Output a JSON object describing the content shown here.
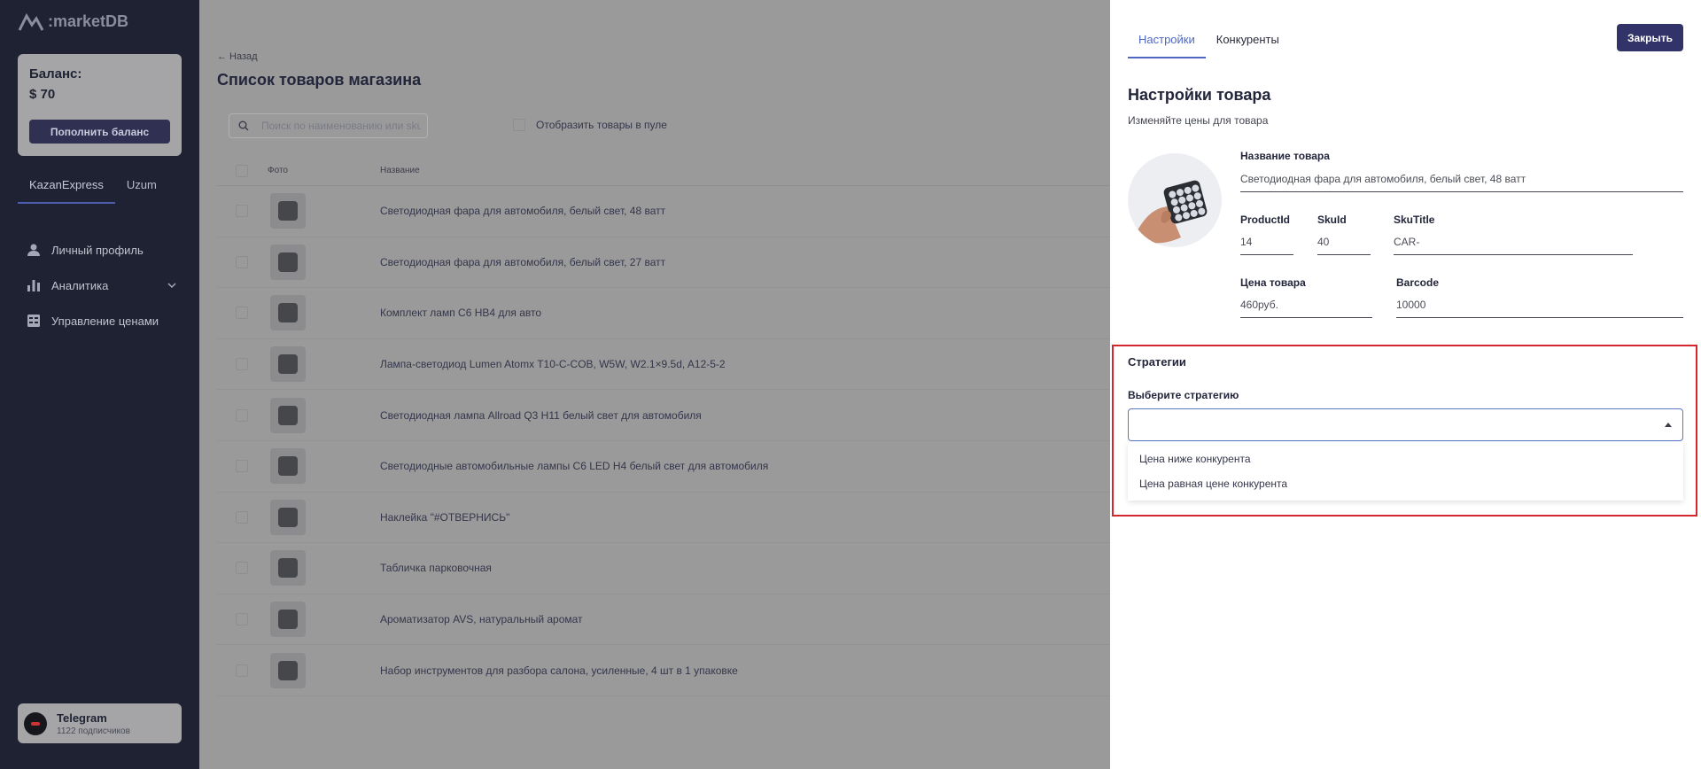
{
  "brand": {
    "logo_text": ":marketDB"
  },
  "balance": {
    "label": "Баланс:",
    "value": "$ 70",
    "topup_label": "Пополнить баланс"
  },
  "platforms": {
    "tabs": [
      {
        "label": "KazanExpress",
        "active": true
      },
      {
        "label": "Uzum",
        "active": false
      }
    ]
  },
  "nav": {
    "items": [
      {
        "label": "Личный профиль",
        "icon": "user-icon"
      },
      {
        "label": "Аналитика",
        "icon": "bar-chart-icon",
        "expandable": true
      },
      {
        "label": "Управление ценами",
        "icon": "table-icon"
      }
    ]
  },
  "telegram": {
    "title": "Telegram",
    "subtitle": "1122 подписчиков"
  },
  "main": {
    "back_label": "← Назад",
    "title": "Список товаров магазина",
    "search_placeholder": "Поиск по наименованию или skuId",
    "pool_label": "Отобразить товары в пуле",
    "columns": {
      "photo": "Фото",
      "name": "Название"
    },
    "rows": [
      "Светодиодная фара для автомобиля, белый свет, 48 ватт",
      "Светодиодная фара для автомобиля, белый свет, 27 ватт",
      "Комплект ламп С6 HB4 для авто",
      "Лампа-светодиод Lumen Atomx T10-C-COB, W5W, W2.1×9.5d, A12-5-2",
      "Светодиодная лампа Allroad Q3 H11 белый свет для автомобиля",
      "Светодиодные автомобильные лампы С6 LED H4 белый свет для автомобиля",
      "Наклейка \"#ОТВЕРНИСЬ\"",
      "Табличка парковочная",
      "Ароматизатор AVS, натуральный аромат",
      "Набор инструментов для разбора салона, усиленные, 4 шт в 1 упаковке"
    ]
  },
  "drawer": {
    "tabs": [
      {
        "label": "Настройки",
        "active": true
      },
      {
        "label": "Конкуренты",
        "active": false
      }
    ],
    "close_label": "Закрыть",
    "title": "Настройки товара",
    "description": "Изменяйте цены для товара",
    "fields": {
      "name_label": "Название товара",
      "name_value": "Светодиодная фара для автомобиля, белый свет, 48 ватт",
      "product_id_label": "ProductId",
      "product_id_value": "14",
      "sku_id_label": "SkuId",
      "sku_id_value": "40",
      "sku_title_label": "SkuTitle",
      "sku_title_value": "CAR-",
      "price_label": "Цена товара",
      "price_value": "460руб.",
      "barcode_label": "Barcode",
      "barcode_value": "10000"
    },
    "strategies": {
      "title": "Стратегии",
      "select_label": "Выберите стратегию",
      "selected": "",
      "options": [
        "Цена ниже конкурента",
        "Цена равная цене конкурента"
      ]
    }
  },
  "colors": {
    "accent": "#4f67c2",
    "sidebar_bg": "#1f2232",
    "highlight_border": "#d3262d",
    "close_button": "#323368"
  }
}
